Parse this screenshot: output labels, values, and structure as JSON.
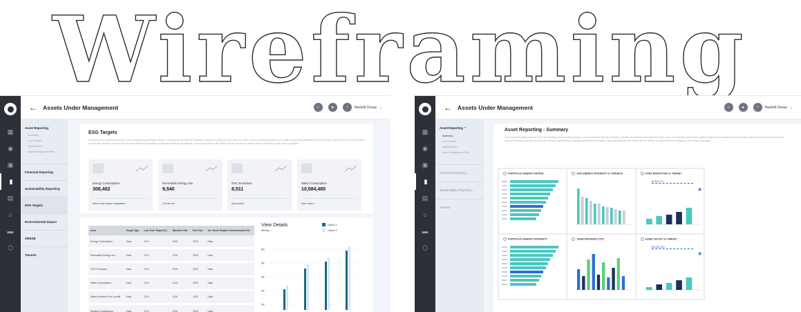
{
  "hero_title": "Wireframing",
  "left": {
    "header": {
      "title": "Assets Under Management",
      "account": "Hackett Group"
    },
    "subnav": [
      {
        "label": "Asset Reporting",
        "children": [
          "Summary",
          "Our Portfolio",
          "Digital Assets",
          "Asset Management Plan"
        ]
      },
      {
        "label": "Financial Reporting"
      },
      {
        "label": "Sustainability Reporting"
      },
      {
        "label": "ESG Targets"
      },
      {
        "label": "Environmental Impact"
      },
      {
        "label": "GRESB"
      },
      {
        "label": "Tenants"
      }
    ],
    "section_title": "ESG Targets",
    "lorem": "Lorem ipsum is simply dummy text of the printing and typesetting industry. Lorem ipsum has been the industry's standard dummy text ever since the 1500s, when an unknown printer took a galley of type and scrambled it to make a type specimen book. It has survived not only five centuries, but also the leap into electronic typesetting, remaining essentially unchanged. It was popularised in the 1960s with the release of Letraset sheets containing Lorem Ipsum passages.",
    "kpis": [
      {
        "label": "Energy Consumption",
        "value": "308,402",
        "foot": "Nemo enim ipsam voluptatem"
      },
      {
        "label": "Renewable Energy Use",
        "value": "9,540",
        "foot": "Ut enim ad"
      },
      {
        "label": "GHC Emissions",
        "value": "8,511",
        "foot": "Quis autem"
      },
      {
        "label": "Water Consumption",
        "value": "10,584,485",
        "foot": "Nam Libero"
      }
    ],
    "table": {
      "headers": [
        "Area",
        "Target Type",
        "Low Term Target (%)",
        "Baseline Year",
        "End Year",
        "Are These Targets Communicated Ext"
      ],
      "rows": [
        [
          "Energy Consumption",
          "Data",
          "21%",
          "2019",
          "2023",
          "Data"
        ],
        [
          "Renewable Energy Use",
          "Data",
          "21%",
          "2019",
          "2023",
          "Data"
        ],
        [
          "GHC Emissions",
          "Data",
          "21%",
          "2019",
          "2023",
          "Data"
        ],
        [
          "Water Consumption",
          "Data",
          "21%",
          "2019",
          "2023",
          "Data"
        ],
        [
          "Water Diverted From Landfill",
          "Data",
          "21%",
          "2019",
          "2023",
          "Data"
        ],
        [
          "Building Certifications",
          "Data",
          "21%",
          "2019",
          "2023",
          "Data"
        ]
      ]
    },
    "view_details": {
      "title": "View Details",
      "period": "Weekly",
      "legend": [
        "Option 1",
        "Option 2"
      ],
      "y_ticks": [
        "6K",
        "5K",
        "4K",
        "3K",
        "2K"
      ]
    }
  },
  "right": {
    "header": {
      "title": "Assets Under Management",
      "account": "Hackett Group"
    },
    "subnav": [
      {
        "label": "Asset Reporting",
        "children": [
          "Summary",
          "Our Portfolio",
          "Digital Assets",
          "Asset Management Plan"
        ]
      },
      {
        "label": "Financial Reporting"
      },
      {
        "label": "Sustainability Reporting"
      },
      {
        "label": "Tenants"
      }
    ],
    "section_title": "Asset Reporting - Summary",
    "lorem": "Lorem ipsum is simply dummy text of the printing and typesetting industry. Lorem ipsum has been the industry's standard dummy text ever since the 1500s, when an unknown printer took a galley of type and scrambled it to make a type specimen book. It has survived not only five centuries, but also the leap into electronic typesetting, remaining essentially unchanged. It was popularised in the 1960s with the release of Letraset sheets containing Lorem Ipsum passages.",
    "mini_charts": [
      {
        "title": "PORTFOLIO ENERGY RATING"
      },
      {
        "title": "SITE ENERGY INTENSITY vs TARGETS"
      },
      {
        "title": "OPEX REDUCTION vs TARGET",
        "amount": "$2,840,976"
      },
      {
        "title": "PORTFOLIO ENERGY INTENSITY"
      },
      {
        "title": "TEAM PROGESS (YTD)"
      },
      {
        "title": "ASSET UPLIFT vs TARGET",
        "amount": "$28,653,416"
      }
    ]
  },
  "colors": {
    "teal": "#49c8c0",
    "navy": "#1b2f5a",
    "blue": "#2e6fd8",
    "green": "#5ad07a",
    "rail": "#2c3138"
  }
}
